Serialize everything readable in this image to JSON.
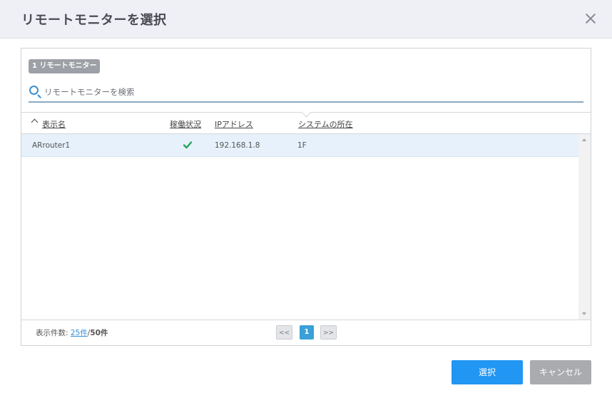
{
  "dialog": {
    "title": "リモートモニターを選択"
  },
  "selected_chip": "1 リモートモニター",
  "search": {
    "placeholder": "リモートモニターを検索",
    "value": ""
  },
  "table": {
    "columns": [
      "表示名",
      "稼働状況",
      "IPアドレス",
      "システムの所在"
    ],
    "sort": {
      "column": "表示名",
      "direction": "ascending"
    },
    "rows": [
      {
        "name": "ARrouter1",
        "status": "running",
        "ip": "192.168.1.8",
        "location": "1F"
      }
    ]
  },
  "footer": {
    "count_label": "表示件数:",
    "page_size": "25件",
    "separator": "/",
    "total": "50件"
  },
  "pagination": {
    "prev": "<<",
    "current": "1",
    "next": ">>"
  },
  "buttons": {
    "select": "選択",
    "cancel": "キャンセル"
  },
  "colors": {
    "accent": "#2196f3",
    "status_ok": "#27a35a",
    "row_selected": "#e6f1fb",
    "header_bg": "#eff0f5"
  }
}
